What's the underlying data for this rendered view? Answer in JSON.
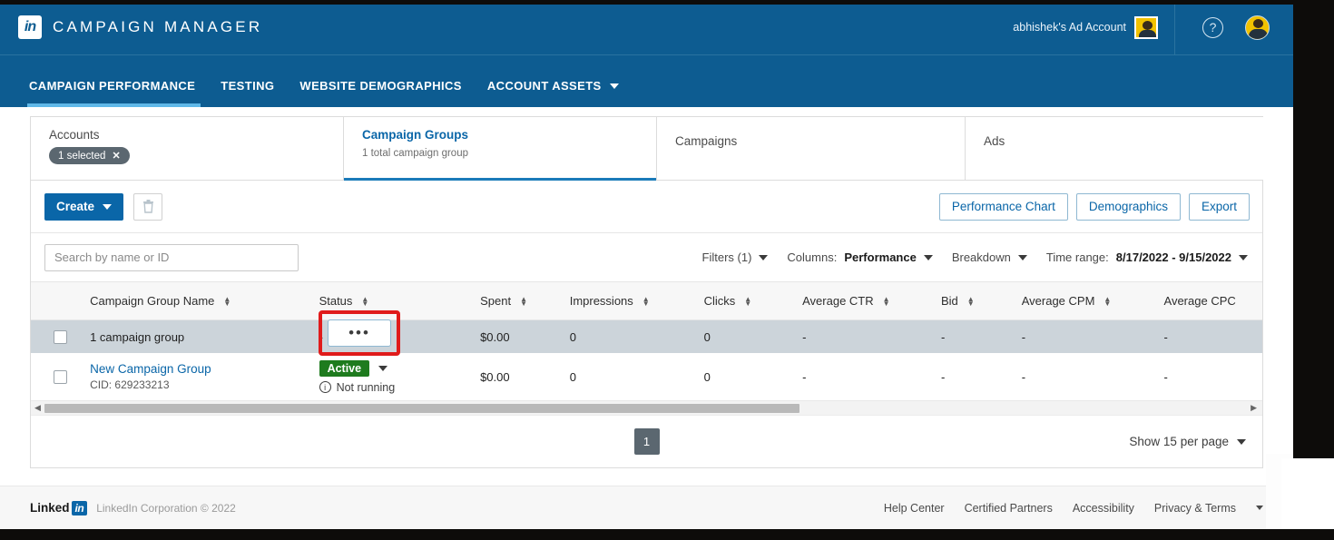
{
  "header": {
    "brand": "CAMPAIGN MANAGER",
    "logo_text": "in",
    "account_name": "abhishek's Ad Account",
    "help_icon": "?",
    "nav": [
      {
        "label": "CAMPAIGN PERFORMANCE",
        "active": true,
        "caret": false
      },
      {
        "label": "TESTING",
        "active": false,
        "caret": false
      },
      {
        "label": "WEBSITE DEMOGRAPHICS",
        "active": false,
        "caret": false
      },
      {
        "label": "ACCOUNT ASSETS",
        "active": false,
        "caret": true
      }
    ]
  },
  "tabs": [
    {
      "title": "Accounts",
      "chip": "1 selected",
      "chip_x": "✕",
      "sub": "",
      "selected": false
    },
    {
      "title": "Campaign Groups",
      "chip": "",
      "sub": "1 total campaign group",
      "selected": true
    },
    {
      "title": "Campaigns",
      "chip": "",
      "sub": "",
      "selected": false
    },
    {
      "title": "Ads",
      "chip": "",
      "sub": "",
      "selected": false
    }
  ],
  "toolbar": {
    "create_label": "Create",
    "trash_icon": "trash-icon",
    "performance_chart": "Performance Chart",
    "demographics": "Demographics",
    "export": "Export"
  },
  "filters": {
    "search_placeholder": "Search by name or ID",
    "search_value": "",
    "filters_label": "Filters (1)",
    "columns_prefix": "Columns:",
    "columns_value": "Performance",
    "breakdown_label": "Breakdown",
    "timerange_prefix": "Time range:",
    "timerange_value": "8/17/2022 - 9/15/2022"
  },
  "table": {
    "columns": [
      "Campaign Group Name",
      "Status",
      "Spent",
      "Impressions",
      "Clicks",
      "Average CTR",
      "Bid",
      "Average CPM",
      "Average CPC"
    ],
    "summary_row": {
      "name": "1 campaign group",
      "status": "-",
      "spent": "$0.00",
      "impressions": "0",
      "clicks": "0",
      "avg_ctr": "-",
      "bid": "-",
      "avg_cpm": "-",
      "avg_cpc": "-"
    },
    "rows": [
      {
        "name": "New Campaign Group",
        "cid": "CID: 629233213",
        "actions_label": "•••",
        "status_badge": "Active",
        "status_note": "Not running",
        "spent": "$0.00",
        "impressions": "0",
        "clicks": "0",
        "avg_ctr": "-",
        "bid": "-",
        "avg_cpm": "-",
        "avg_cpc": "-"
      }
    ]
  },
  "pagination": {
    "page": "1",
    "per_page": "Show 15 per page"
  },
  "footer": {
    "logo_linked": "Linked",
    "logo_in": "in",
    "copyright": "LinkedIn Corporation © 2022",
    "links": [
      "Help Center",
      "Certified Partners",
      "Accessibility",
      "Privacy & Terms"
    ]
  },
  "colors": {
    "header_blue": "#0d5c91",
    "accent_blue": "#0a66a8",
    "active_green": "#1e7b1e",
    "highlight_red": "#e01b1b",
    "summary_row_bg": "#ccd4da"
  }
}
